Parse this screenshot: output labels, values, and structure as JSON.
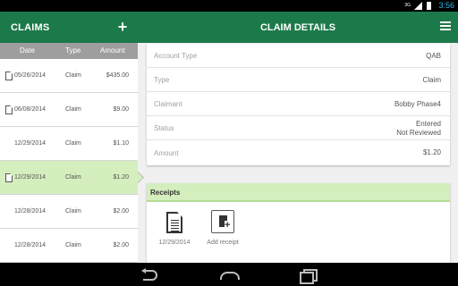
{
  "status_bar": {
    "network": "3G",
    "time": "3:56"
  },
  "left_panel": {
    "title": "CLAIMS",
    "add_icon": "+",
    "columns": [
      "Date",
      "Type",
      "Amount"
    ],
    "rows": [
      {
        "date": "05/26/2014",
        "type": "Claim",
        "amount": "$435.00",
        "has_doc": true,
        "selected": false
      },
      {
        "date": "06/08/2014",
        "type": "Claim",
        "amount": "$9.00",
        "has_doc": true,
        "selected": false
      },
      {
        "date": "12/29/2014",
        "type": "Claim",
        "amount": "$1.10",
        "has_doc": false,
        "selected": false
      },
      {
        "date": "12/29/2014",
        "type": "Claim",
        "amount": "$1.20",
        "has_doc": true,
        "selected": true
      },
      {
        "date": "12/28/2014",
        "type": "Claim",
        "amount": "$2.00",
        "has_doc": false,
        "selected": false
      },
      {
        "date": "12/28/2014",
        "type": "Claim",
        "amount": "$2.00",
        "has_doc": false,
        "selected": false
      }
    ]
  },
  "detail_panel": {
    "title": "CLAIM DETAILS",
    "fields": [
      {
        "label": "Account Type",
        "value": "QAB"
      },
      {
        "label": "Type",
        "value": "Claim"
      },
      {
        "label": "Claimant",
        "value": "Bobby Phase4"
      },
      {
        "label": "Status",
        "value": "Entered",
        "value2": "Not Reviewed"
      },
      {
        "label": "Amount",
        "value": "$1.20"
      }
    ]
  },
  "receipts": {
    "heading": "Receipts",
    "items": [
      {
        "label": "12/29/2014",
        "icon": "document-icon"
      },
      {
        "label": "Add receipt",
        "icon": "add-receipt-icon"
      }
    ]
  },
  "colors": {
    "header": "#1c7a4a",
    "selected": "#d4eebe",
    "column_header": "#9e9e9e",
    "clock": "#33b5e5"
  }
}
